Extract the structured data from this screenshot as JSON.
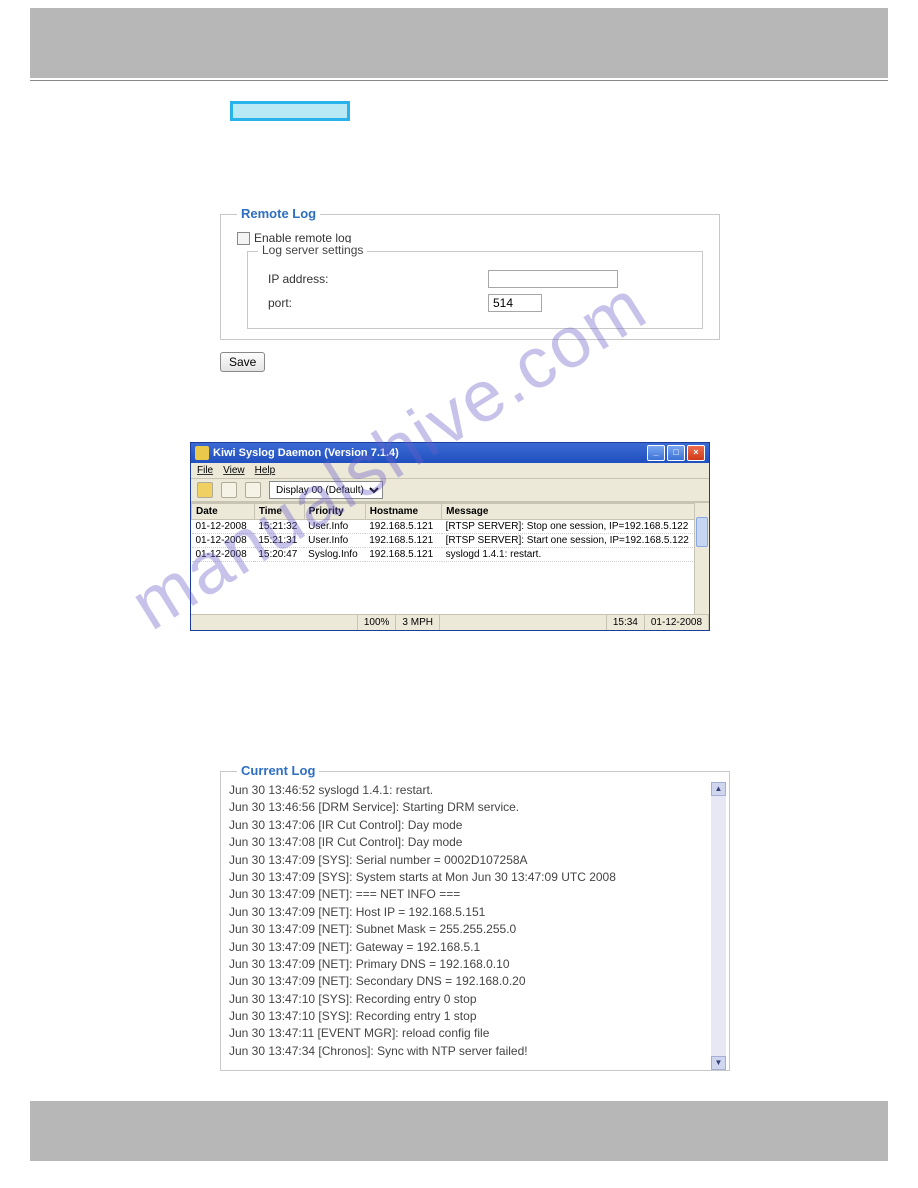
{
  "highlight_text": "",
  "remote_log": {
    "title": "Remote Log",
    "enable_label": "Enable remote log",
    "enable_checked": false,
    "fieldset_legend": "Log server settings",
    "ip_label": "IP address:",
    "ip_value": "",
    "port_label": "port:",
    "port_value": "514",
    "save_label": "Save"
  },
  "kiwi": {
    "title": "Kiwi Syslog Daemon (Version 7.1.4)",
    "menus": [
      "File",
      "View",
      "Help"
    ],
    "display_select": [
      "Display 00 (Default)"
    ],
    "columns": [
      "Date",
      "Time",
      "Priority",
      "Hostname",
      "Message"
    ],
    "rows": [
      {
        "date": "01-12-2008",
        "time": "15:21:32",
        "priority": "User.Info",
        "hostname": "192.168.5.121",
        "message": "[RTSP SERVER]: Stop one session, IP=192.168.5.122"
      },
      {
        "date": "01-12-2008",
        "time": "15:21:31",
        "priority": "User.Info",
        "hostname": "192.168.5.121",
        "message": "[RTSP SERVER]: Start one session, IP=192.168.5.122"
      },
      {
        "date": "01-12-2008",
        "time": "15:20:47",
        "priority": "Syslog.Info",
        "hostname": "192.168.5.121",
        "message": "syslogd 1.4.1: restart."
      }
    ],
    "status": {
      "pct": "100%",
      "mph": "3 MPH",
      "time": "15:34",
      "date": "01-12-2008"
    }
  },
  "current_log": {
    "title": "Current Log",
    "entries": [
      "Jun 30 13:46:52 syslogd 1.4.1: restart.",
      "Jun 30 13:46:56 [DRM Service]: Starting DRM service.",
      "Jun 30 13:47:06 [IR Cut Control]: Day mode",
      "Jun 30 13:47:08 [IR Cut Control]: Day mode",
      "Jun 30 13:47:09 [SYS]: Serial number = 0002D107258A",
      "Jun 30 13:47:09 [SYS]: System starts at Mon Jun 30 13:47:09 UTC 2008",
      "Jun 30 13:47:09 [NET]: === NET INFO ===",
      "Jun 30 13:47:09 [NET]: Host IP = 192.168.5.151",
      "Jun 30 13:47:09 [NET]: Subnet Mask = 255.255.255.0",
      "Jun 30 13:47:09 [NET]: Gateway = 192.168.5.1",
      "Jun 30 13:47:09 [NET]: Primary DNS = 192.168.0.10",
      "Jun 30 13:47:09 [NET]: Secondary DNS = 192.168.0.20",
      "Jun 30 13:47:10 [SYS]: Recording entry 0 stop",
      "Jun 30 13:47:10 [SYS]: Recording entry 1 stop",
      "Jun 30 13:47:11 [EVENT MGR]: reload config file",
      "Jun 30 13:47:34 [Chronos]: Sync with NTP server failed!"
    ]
  },
  "watermark": "manualshive.com"
}
